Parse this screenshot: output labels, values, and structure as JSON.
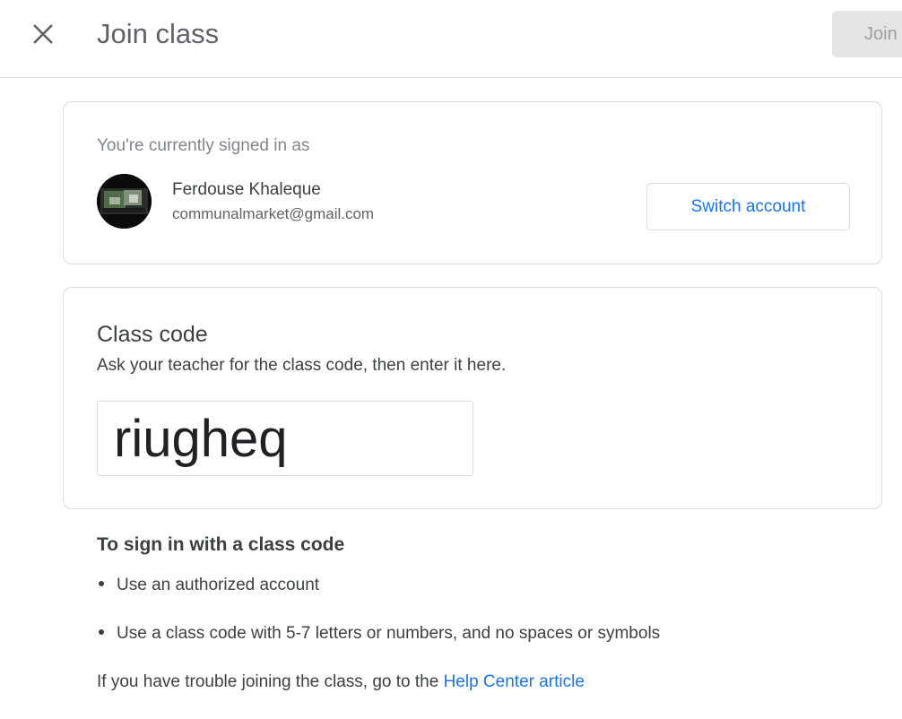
{
  "header": {
    "title": "Join class",
    "join_label": "Join"
  },
  "account": {
    "signed_in_label": "You're currently signed in as",
    "name": "Ferdouse Khaleque",
    "email": "communalmarket@gmail.com",
    "switch_label": "Switch account"
  },
  "class_code": {
    "heading": "Class code",
    "instructions": "Ask your teacher for the class code, then enter it here.",
    "value": "riugheq"
  },
  "help": {
    "heading": "To sign in with a class code",
    "bullets": [
      "Use an authorized account",
      "Use a class code with 5-7 letters or numbers, and no spaces or symbols"
    ],
    "trouble_text": "If you have trouble joining the class, go to the ",
    "link_text": "Help Center article"
  },
  "icons": {
    "close": "close-icon",
    "avatar": "avatar-image"
  },
  "colors": {
    "accent": "#1a73e8",
    "border": "#dadce0",
    "text": "#3c4043",
    "muted": "#5f6368",
    "disabled_bg": "#e4e4e4"
  }
}
